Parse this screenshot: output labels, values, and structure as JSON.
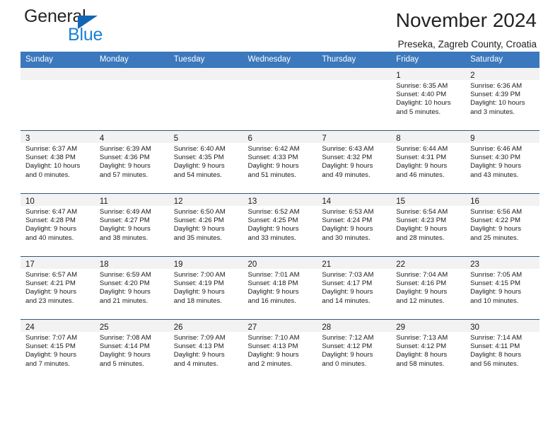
{
  "logo": {
    "primary_text": "General",
    "secondary_text": "Blue",
    "primary_color": "#262626",
    "secondary_color": "#1a7fd4",
    "triangle_color": "#1266b3"
  },
  "header": {
    "title": "November 2024",
    "subtitle": "Preseka, Zagreb County, Croatia"
  },
  "theme": {
    "header_bg": "#3b78bd",
    "header_text": "#ffffff",
    "daynum_band_bg": "#f2f2f2",
    "row_divider": "#36577a",
    "body_text": "#1a1a1a"
  },
  "weekdays": [
    "Sunday",
    "Monday",
    "Tuesday",
    "Wednesday",
    "Thursday",
    "Friday",
    "Saturday"
  ],
  "weeks": [
    [
      {
        "day": "",
        "lines": []
      },
      {
        "day": "",
        "lines": []
      },
      {
        "day": "",
        "lines": []
      },
      {
        "day": "",
        "lines": []
      },
      {
        "day": "",
        "lines": []
      },
      {
        "day": "1",
        "lines": [
          "Sunrise: 6:35 AM",
          "Sunset: 4:40 PM",
          "Daylight: 10 hours",
          "and 5 minutes."
        ]
      },
      {
        "day": "2",
        "lines": [
          "Sunrise: 6:36 AM",
          "Sunset: 4:39 PM",
          "Daylight: 10 hours",
          "and 3 minutes."
        ]
      }
    ],
    [
      {
        "day": "3",
        "lines": [
          "Sunrise: 6:37 AM",
          "Sunset: 4:38 PM",
          "Daylight: 10 hours",
          "and 0 minutes."
        ]
      },
      {
        "day": "4",
        "lines": [
          "Sunrise: 6:39 AM",
          "Sunset: 4:36 PM",
          "Daylight: 9 hours",
          "and 57 minutes."
        ]
      },
      {
        "day": "5",
        "lines": [
          "Sunrise: 6:40 AM",
          "Sunset: 4:35 PM",
          "Daylight: 9 hours",
          "and 54 minutes."
        ]
      },
      {
        "day": "6",
        "lines": [
          "Sunrise: 6:42 AM",
          "Sunset: 4:33 PM",
          "Daylight: 9 hours",
          "and 51 minutes."
        ]
      },
      {
        "day": "7",
        "lines": [
          "Sunrise: 6:43 AM",
          "Sunset: 4:32 PM",
          "Daylight: 9 hours",
          "and 49 minutes."
        ]
      },
      {
        "day": "8",
        "lines": [
          "Sunrise: 6:44 AM",
          "Sunset: 4:31 PM",
          "Daylight: 9 hours",
          "and 46 minutes."
        ]
      },
      {
        "day": "9",
        "lines": [
          "Sunrise: 6:46 AM",
          "Sunset: 4:30 PM",
          "Daylight: 9 hours",
          "and 43 minutes."
        ]
      }
    ],
    [
      {
        "day": "10",
        "lines": [
          "Sunrise: 6:47 AM",
          "Sunset: 4:28 PM",
          "Daylight: 9 hours",
          "and 40 minutes."
        ]
      },
      {
        "day": "11",
        "lines": [
          "Sunrise: 6:49 AM",
          "Sunset: 4:27 PM",
          "Daylight: 9 hours",
          "and 38 minutes."
        ]
      },
      {
        "day": "12",
        "lines": [
          "Sunrise: 6:50 AM",
          "Sunset: 4:26 PM",
          "Daylight: 9 hours",
          "and 35 minutes."
        ]
      },
      {
        "day": "13",
        "lines": [
          "Sunrise: 6:52 AM",
          "Sunset: 4:25 PM",
          "Daylight: 9 hours",
          "and 33 minutes."
        ]
      },
      {
        "day": "14",
        "lines": [
          "Sunrise: 6:53 AM",
          "Sunset: 4:24 PM",
          "Daylight: 9 hours",
          "and 30 minutes."
        ]
      },
      {
        "day": "15",
        "lines": [
          "Sunrise: 6:54 AM",
          "Sunset: 4:23 PM",
          "Daylight: 9 hours",
          "and 28 minutes."
        ]
      },
      {
        "day": "16",
        "lines": [
          "Sunrise: 6:56 AM",
          "Sunset: 4:22 PM",
          "Daylight: 9 hours",
          "and 25 minutes."
        ]
      }
    ],
    [
      {
        "day": "17",
        "lines": [
          "Sunrise: 6:57 AM",
          "Sunset: 4:21 PM",
          "Daylight: 9 hours",
          "and 23 minutes."
        ]
      },
      {
        "day": "18",
        "lines": [
          "Sunrise: 6:59 AM",
          "Sunset: 4:20 PM",
          "Daylight: 9 hours",
          "and 21 minutes."
        ]
      },
      {
        "day": "19",
        "lines": [
          "Sunrise: 7:00 AM",
          "Sunset: 4:19 PM",
          "Daylight: 9 hours",
          "and 18 minutes."
        ]
      },
      {
        "day": "20",
        "lines": [
          "Sunrise: 7:01 AM",
          "Sunset: 4:18 PM",
          "Daylight: 9 hours",
          "and 16 minutes."
        ]
      },
      {
        "day": "21",
        "lines": [
          "Sunrise: 7:03 AM",
          "Sunset: 4:17 PM",
          "Daylight: 9 hours",
          "and 14 minutes."
        ]
      },
      {
        "day": "22",
        "lines": [
          "Sunrise: 7:04 AM",
          "Sunset: 4:16 PM",
          "Daylight: 9 hours",
          "and 12 minutes."
        ]
      },
      {
        "day": "23",
        "lines": [
          "Sunrise: 7:05 AM",
          "Sunset: 4:15 PM",
          "Daylight: 9 hours",
          "and 10 minutes."
        ]
      }
    ],
    [
      {
        "day": "24",
        "lines": [
          "Sunrise: 7:07 AM",
          "Sunset: 4:15 PM",
          "Daylight: 9 hours",
          "and 7 minutes."
        ]
      },
      {
        "day": "25",
        "lines": [
          "Sunrise: 7:08 AM",
          "Sunset: 4:14 PM",
          "Daylight: 9 hours",
          "and 5 minutes."
        ]
      },
      {
        "day": "26",
        "lines": [
          "Sunrise: 7:09 AM",
          "Sunset: 4:13 PM",
          "Daylight: 9 hours",
          "and 4 minutes."
        ]
      },
      {
        "day": "27",
        "lines": [
          "Sunrise: 7:10 AM",
          "Sunset: 4:13 PM",
          "Daylight: 9 hours",
          "and 2 minutes."
        ]
      },
      {
        "day": "28",
        "lines": [
          "Sunrise: 7:12 AM",
          "Sunset: 4:12 PM",
          "Daylight: 9 hours",
          "and 0 minutes."
        ]
      },
      {
        "day": "29",
        "lines": [
          "Sunrise: 7:13 AM",
          "Sunset: 4:12 PM",
          "Daylight: 8 hours",
          "and 58 minutes."
        ]
      },
      {
        "day": "30",
        "lines": [
          "Sunrise: 7:14 AM",
          "Sunset: 4:11 PM",
          "Daylight: 8 hours",
          "and 56 minutes."
        ]
      }
    ]
  ]
}
